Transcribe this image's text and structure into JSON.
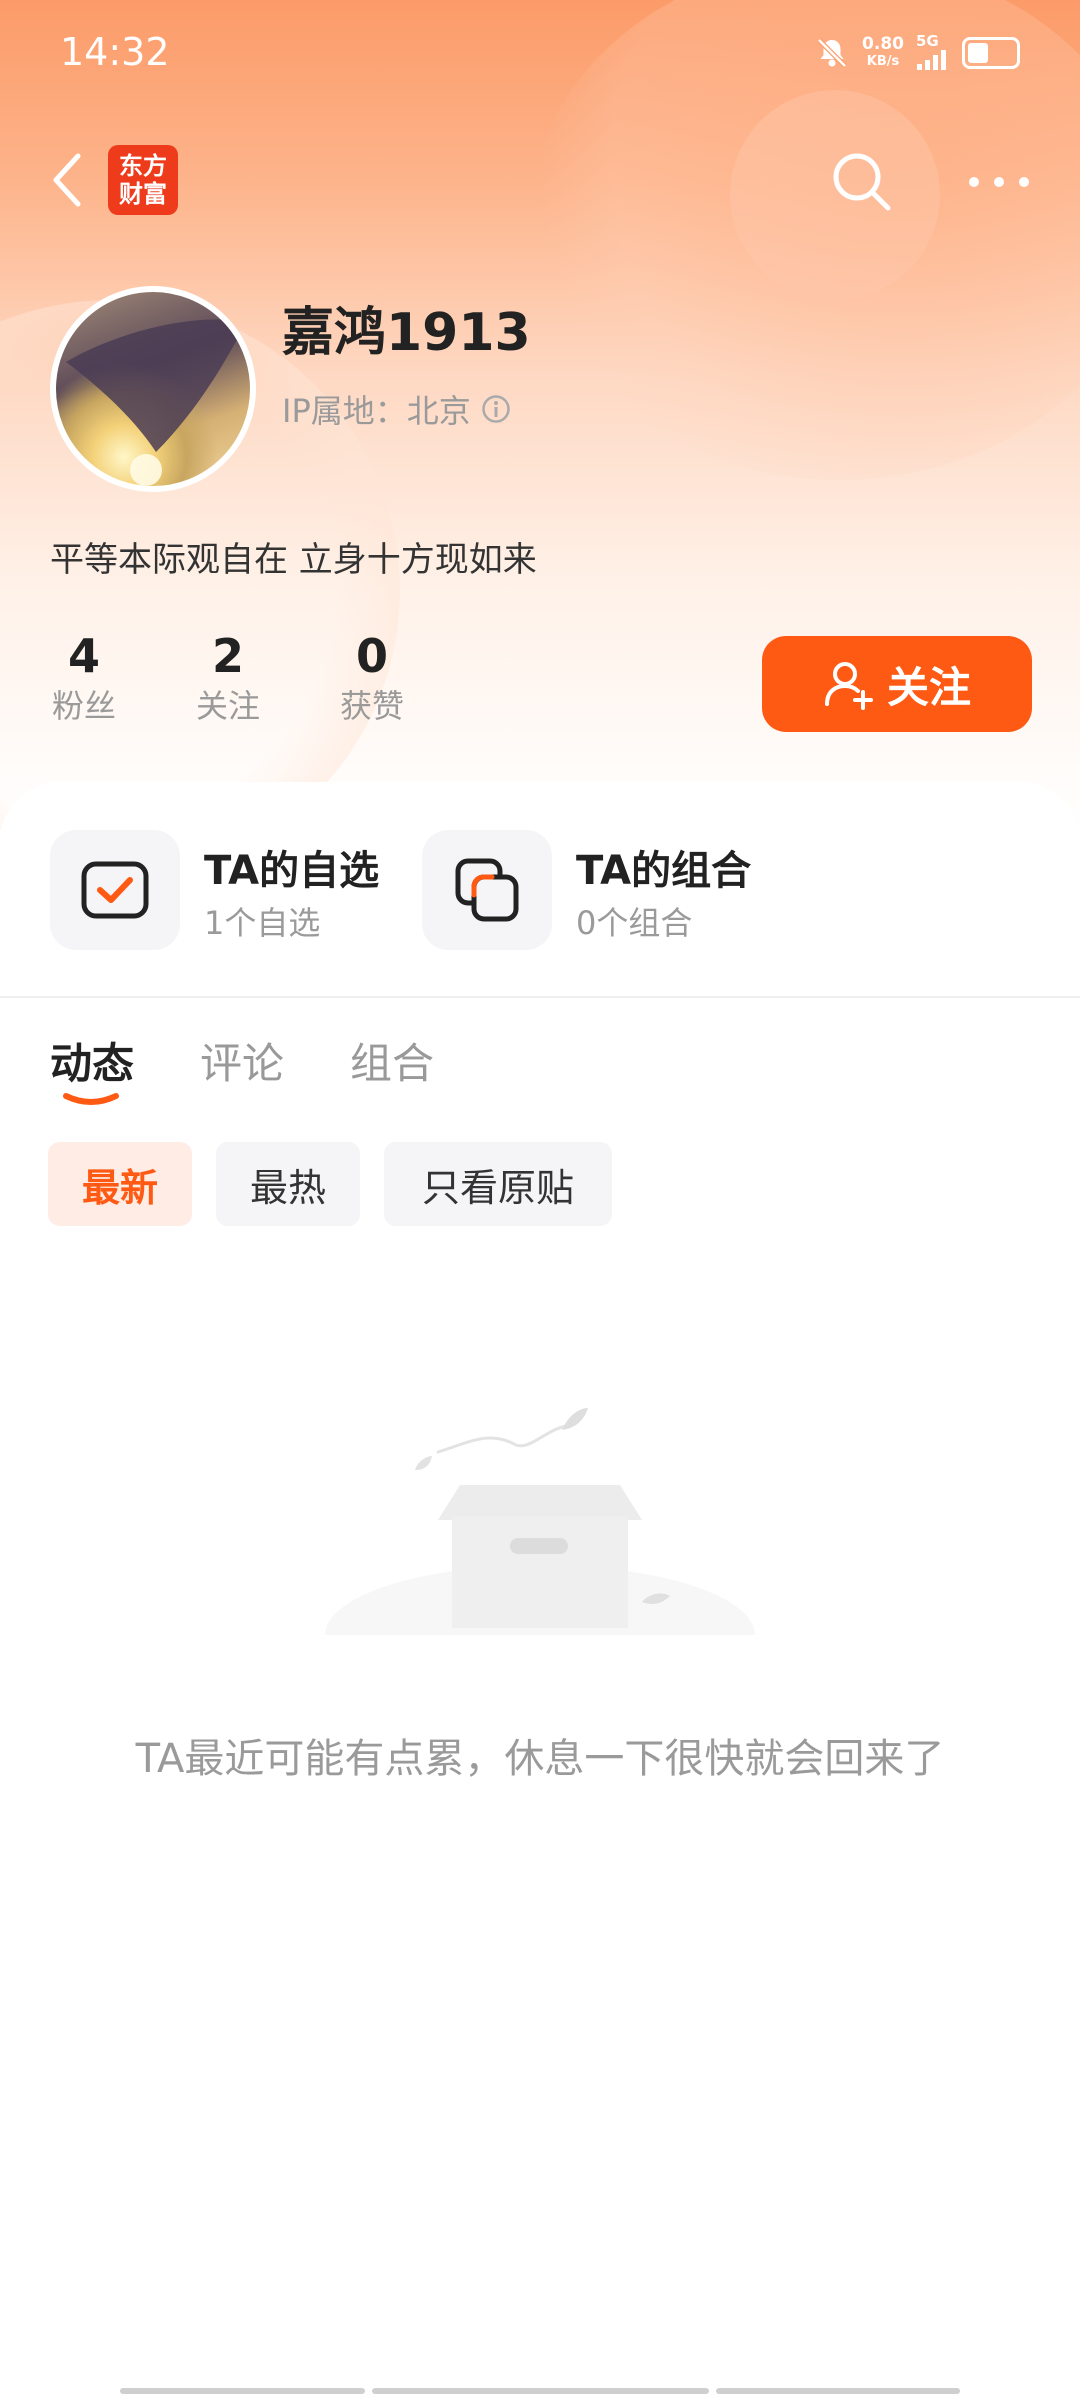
{
  "status_bar": {
    "time": "14:32",
    "net_speed_value": "0.80",
    "net_speed_unit": "KB/s",
    "signal_label": "5G",
    "icons": [
      "bell-muted-icon",
      "signal-icon",
      "battery-icon"
    ]
  },
  "nav": {
    "logo_line1": "东方",
    "logo_line2": "财富",
    "icons": [
      "back-icon",
      "search-icon",
      "more-icon"
    ],
    "brand_color": "#ee3b1c"
  },
  "profile": {
    "name": "嘉鸿1913",
    "ip_label": "IP属地：北京",
    "bio": "平等本际观自在 立身十方现如来"
  },
  "stats": [
    {
      "value": "4",
      "label": "粉丝"
    },
    {
      "value": "2",
      "label": "关注"
    },
    {
      "value": "0",
      "label": "获赞"
    }
  ],
  "follow_button": {
    "label": "关注",
    "color": "#ff5a14"
  },
  "features": [
    {
      "title": "TA的自选",
      "subtitle": "1个自选"
    },
    {
      "title": "TA的组合",
      "subtitle": "0个组合"
    }
  ],
  "tabs": [
    {
      "label": "动态",
      "active": true
    },
    {
      "label": "评论",
      "active": false
    },
    {
      "label": "组合",
      "active": false
    }
  ],
  "filters": [
    {
      "label": "最新",
      "active": true
    },
    {
      "label": "最热",
      "active": false
    },
    {
      "label": "只看原贴",
      "active": false
    }
  ],
  "empty_state": {
    "message": "TA最近可能有点累，休息一下很快就会回来了"
  }
}
